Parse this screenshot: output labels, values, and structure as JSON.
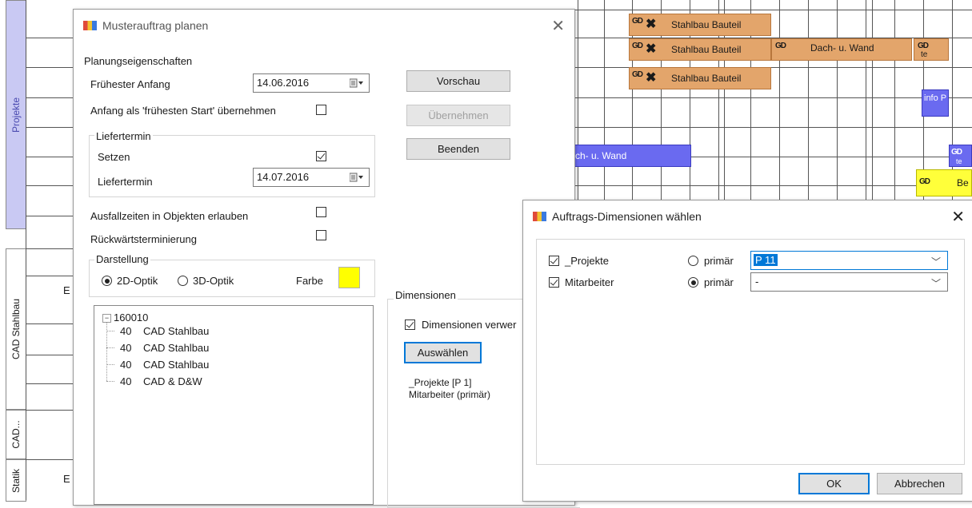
{
  "side_tabs": [
    {
      "label": "Projekte"
    },
    {
      "label": "CAD Stahlbau"
    },
    {
      "label": "CAD..."
    },
    {
      "label": "Statik"
    }
  ],
  "gantt": {
    "row_letters": [
      "E",
      "E"
    ],
    "bars": [
      {
        "gd": "GD",
        "label": "Stahlbau Bauteil"
      },
      {
        "gd": "GD",
        "label": "Stahlbau Bauteil"
      },
      {
        "gd": "GD",
        "label": "Dach- u. Wand"
      },
      {
        "gd": "GD",
        "label": "te"
      },
      {
        "gd": "GD",
        "label": "Stahlbau Bauteil"
      },
      {
        "gd": "",
        "label": "info P"
      },
      {
        "gd": "",
        "label": "ch- u. Wand"
      },
      {
        "gd": "GD",
        "label": "te"
      },
      {
        "gd": "GD",
        "label": "Be"
      }
    ]
  },
  "plan_dialog": {
    "title": "Musterauftrag planen",
    "section_planning": "Planungseigenschaften",
    "earliest_start_label": "Frühester Anfang",
    "earliest_start_value": "14.06.2016",
    "adopt_start_label": "Anfang als 'frühesten Start' übernehmen",
    "delivery_group": "Liefertermin",
    "set_label": "Setzen",
    "delivery_label": "Liefertermin",
    "delivery_value": "14.07.2016",
    "allow_downtime_label": "Ausfallzeiten in Objekten erlauben",
    "backward_label": "Rückwärtsterminierung",
    "display_group": "Darstellung",
    "opt_2d": "2D-Optik",
    "opt_3d": "3D-Optik",
    "color_label": "Farbe",
    "color_value": "#ffff00",
    "btn_preview": "Vorschau",
    "btn_apply": "Übernehmen",
    "btn_finish": "Beenden",
    "tree": {
      "root": "160010",
      "children": [
        {
          "num": "40",
          "label": "CAD Stahlbau"
        },
        {
          "num": "40",
          "label": "CAD Stahlbau"
        },
        {
          "num": "40",
          "label": "CAD Stahlbau"
        },
        {
          "num": "40",
          "label": "CAD & D&W"
        }
      ]
    },
    "dimensions_group": "Dimensionen",
    "dimensions_use_label": "Dimensionen verwer",
    "btn_select": "Auswählen",
    "dimensions_summary_1": "_Projekte [P 1]",
    "dimensions_summary_2": "Mitarbeiter (primär)"
  },
  "dim_dialog": {
    "title": "Auftrags-Dimensionen wählen",
    "rows": [
      {
        "label": "_Projekte",
        "primary_label": "primär",
        "value": "P 11"
      },
      {
        "label": "Mitarbeiter",
        "primary_label": "primär",
        "value": "-"
      }
    ],
    "btn_ok": "OK",
    "btn_cancel": "Abbrechen"
  }
}
